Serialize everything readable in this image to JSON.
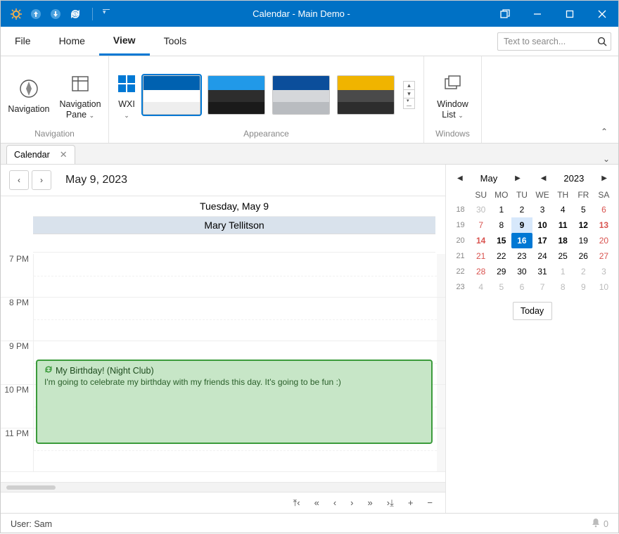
{
  "titlebar": {
    "title": "Calendar - Main Demo -"
  },
  "menu": {
    "tabs": [
      "File",
      "Home",
      "View",
      "Tools"
    ],
    "activeIndex": 2,
    "searchPlaceholder": "Text to search..."
  },
  "ribbon": {
    "navigation": {
      "btn1": "Navigation",
      "btn2_line1": "Navigation",
      "btn2_line2": "Pane",
      "label": "Navigation"
    },
    "themes": {
      "btn": "WXI",
      "label": "Appearance",
      "swatches": [
        {
          "c1": "#0061b0",
          "c2": "#ffffff",
          "c3": "#eeeeee",
          "selected": true
        },
        {
          "c1": "#2199e8",
          "c2": "#2d2d2d",
          "c3": "#1a1a1a"
        },
        {
          "c1": "#0b4e9b",
          "c2": "#d5d7da",
          "c3": "#b9bcc0"
        },
        {
          "c1": "#f0b400",
          "c2": "#4a4a4a",
          "c3": "#2d2d2d"
        }
      ]
    },
    "windows": {
      "btn_line1": "Window",
      "btn_line2": "List",
      "label": "Windows"
    }
  },
  "doctab": {
    "label": "Calendar"
  },
  "calendar": {
    "dateTitle": "May 9, 2023",
    "dayHeader": "Tuesday, May 9",
    "resource": "Mary Tellitson",
    "hours": [
      "7 PM",
      "8 PM",
      "9 PM",
      "10 PM",
      "11 PM"
    ],
    "appt": {
      "title": "My Birthday! (Night Club)",
      "desc": "I'm going to celebrate my birthday with my friends this day. It's going to be fun :)"
    }
  },
  "mini": {
    "month": "May",
    "year": "2023",
    "dow": [
      "SU",
      "MO",
      "TU",
      "WE",
      "TH",
      "FR",
      "SA"
    ],
    "weeks": [
      {
        "wk": "18",
        "d": [
          {
            "v": "30",
            "o": 1
          },
          {
            "v": "1"
          },
          {
            "v": "2"
          },
          {
            "v": "3"
          },
          {
            "v": "4"
          },
          {
            "v": "5"
          },
          {
            "v": "6",
            "r": 1
          }
        ]
      },
      {
        "wk": "19",
        "d": [
          {
            "v": "7",
            "r": 1
          },
          {
            "v": "8"
          },
          {
            "v": "9",
            "sel": 1,
            "b": 1
          },
          {
            "v": "10",
            "b": 1
          },
          {
            "v": "11",
            "b": 1
          },
          {
            "v": "12",
            "b": 1
          },
          {
            "v": "13",
            "r": 1,
            "b": 1
          }
        ]
      },
      {
        "wk": "20",
        "d": [
          {
            "v": "14",
            "r": 1,
            "b": 1
          },
          {
            "v": "15",
            "b": 1
          },
          {
            "v": "16",
            "t": 1,
            "b": 1
          },
          {
            "v": "17",
            "b": 1
          },
          {
            "v": "18",
            "b": 1
          },
          {
            "v": "19"
          },
          {
            "v": "20",
            "r": 1
          }
        ]
      },
      {
        "wk": "21",
        "d": [
          {
            "v": "21",
            "r": 1
          },
          {
            "v": "22"
          },
          {
            "v": "23"
          },
          {
            "v": "24"
          },
          {
            "v": "25"
          },
          {
            "v": "26"
          },
          {
            "v": "27",
            "r": 1
          }
        ]
      },
      {
        "wk": "22",
        "d": [
          {
            "v": "28",
            "r": 1
          },
          {
            "v": "29"
          },
          {
            "v": "30"
          },
          {
            "v": "31"
          },
          {
            "v": "1",
            "o": 1
          },
          {
            "v": "2",
            "o": 1
          },
          {
            "v": "3",
            "o": 1
          }
        ]
      },
      {
        "wk": "23",
        "d": [
          {
            "v": "4",
            "o": 1
          },
          {
            "v": "5",
            "o": 1
          },
          {
            "v": "6",
            "o": 1
          },
          {
            "v": "7",
            "o": 1
          },
          {
            "v": "8",
            "o": 1
          },
          {
            "v": "9",
            "o": 1
          },
          {
            "v": "10",
            "o": 1
          }
        ]
      }
    ],
    "todayBtn": "Today"
  },
  "status": {
    "user": "User: Sam",
    "badge": "0"
  }
}
